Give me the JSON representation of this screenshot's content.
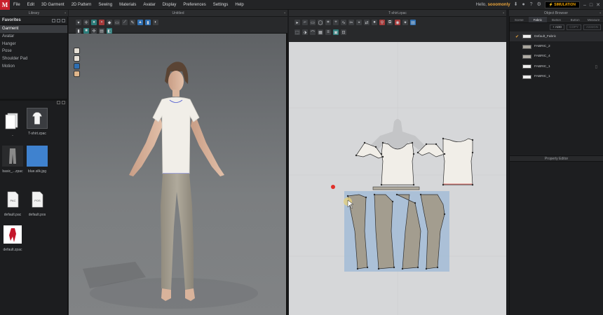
{
  "menu": {
    "logo": "M",
    "items": [
      "File",
      "Edit",
      "3D Garment",
      "2D Pattern",
      "Sewing",
      "Materials",
      "Avatar",
      "Display",
      "Preferences",
      "Settings",
      "Help"
    ],
    "hello_label": "Hello,",
    "username": "sooomonly",
    "simulation_label": "SIMULATION"
  },
  "panels": {
    "library_title": "Library",
    "view3d_title": "Untitled",
    "view2d_title": "T-shirt.zpac",
    "object_browser_title": "Object Browser",
    "property_editor_title": "Property Editor"
  },
  "library": {
    "favorites_label": "Favorites",
    "items": [
      "Garment",
      "Avatar",
      "Hanger",
      "Pose",
      "Shoulder Pad",
      "Motion"
    ],
    "selected_index": 0,
    "files": [
      "..",
      "T-shirt.zpac",
      "basic_...zpac",
      "blue.silk.jpg",
      "default.pac",
      "default.pos",
      "default.zpac"
    ],
    "thumb_labels": {
      "pac": "PAC",
      "pos": "POS"
    },
    "selected_file_index": 1
  },
  "object_browser": {
    "tabs": [
      "Scene",
      "Fabric",
      "Button",
      "Button",
      "Measure"
    ],
    "active_tab": 1,
    "add_label": "+ ADD",
    "copy_label": "COPY",
    "assign_label": "ASSIGN",
    "fabrics": [
      {
        "name": "Default_Fabric",
        "color": "#efefef",
        "checked": true
      },
      {
        "name": "FABRIC_2",
        "color": "#aaa69d",
        "checked": false
      },
      {
        "name": "FABRIC_4",
        "color": "#b1ada6",
        "checked": false
      },
      {
        "name": "FABRIC_1",
        "color": "#efefef",
        "checked": false
      },
      {
        "name": "FABRIC_1",
        "color": "#efefef",
        "checked": false
      }
    ]
  },
  "colors": {
    "accent": "#e8a33a",
    "logo_red": "#c8202c",
    "pants_fabric": "#a39d8f",
    "shirt_fabric": "#f1eee8",
    "selection_blue": "#9cb8d6",
    "point_red": "#e0302a"
  }
}
